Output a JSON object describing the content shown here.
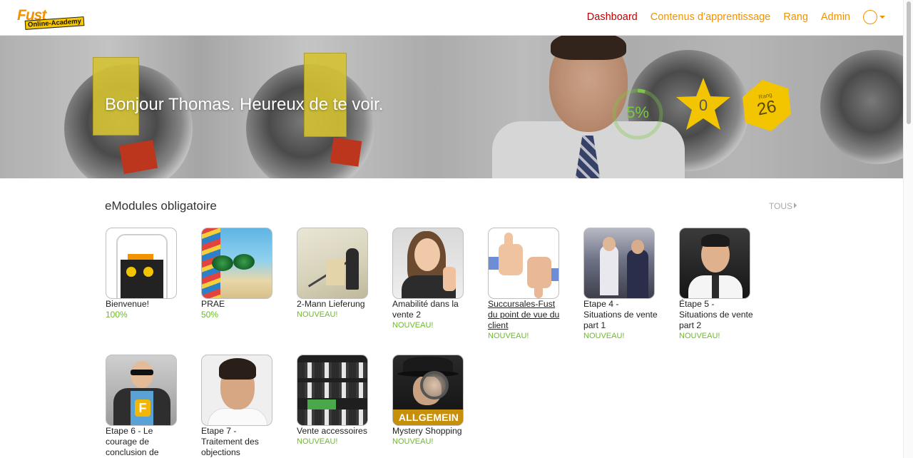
{
  "header": {
    "logo_top": "Fust",
    "logo_bottom": "Online-Academy",
    "nav": [
      {
        "label": "Dashboard",
        "active": true
      },
      {
        "label": "Contenus d’apprentissage"
      },
      {
        "label": "Rang"
      },
      {
        "label": "Admin"
      }
    ],
    "user_icon": "user-circle-icon",
    "accent_color": "#f39200",
    "active_color": "#c00000"
  },
  "hero": {
    "greeting": "Bonjour Thomas. Heureux de te voir.",
    "progress": {
      "label": "5%",
      "value": 0.05,
      "color": "#7ac943"
    },
    "stars": {
      "label": "0",
      "color": "#f2c500"
    },
    "rank": {
      "small": "Rang",
      "label": "26",
      "color": "#f2c500"
    }
  },
  "section": {
    "title": "eModules obligatoire",
    "all_link": "TOUS"
  },
  "modules": [
    {
      "title": "Bienvenue!",
      "status": "100%",
      "thumb": "phone"
    },
    {
      "title": "PRAE",
      "status": "50%",
      "thumb": "beach"
    },
    {
      "title": "2-Mann Lieferung",
      "status": "NOUVEAU!",
      "thumb": "stairs"
    },
    {
      "title": "Amabilité dans la vente 2",
      "status": "NOUVEAU!",
      "thumb": "woman"
    },
    {
      "title": "Succursales-Fust du point de vue du client",
      "status": "NOUVEAU!",
      "thumb": "thumbs"
    },
    {
      "title": "Etape 4 - Situations de vente part 1",
      "status": "NOUVEAU!",
      "thumb": "store"
    },
    {
      "title": "Étape 5 - Situations de vente part 2",
      "status": "NOUVEAU!",
      "thumb": "man"
    },
    {
      "title": "Etape 6 - Le courage de conclusion de",
      "status": "",
      "thumb": "super"
    },
    {
      "title": "Etape 7 - Traitement des objections",
      "status": "",
      "thumb": "man2"
    },
    {
      "title": "Vente accessoires",
      "status": "NOUVEAU!",
      "thumb": "shelf"
    },
    {
      "title": "Mystery Shopping",
      "status": "NOUVEAU!",
      "thumb": "spy",
      "banner": "ALLGEMEIN"
    }
  ]
}
